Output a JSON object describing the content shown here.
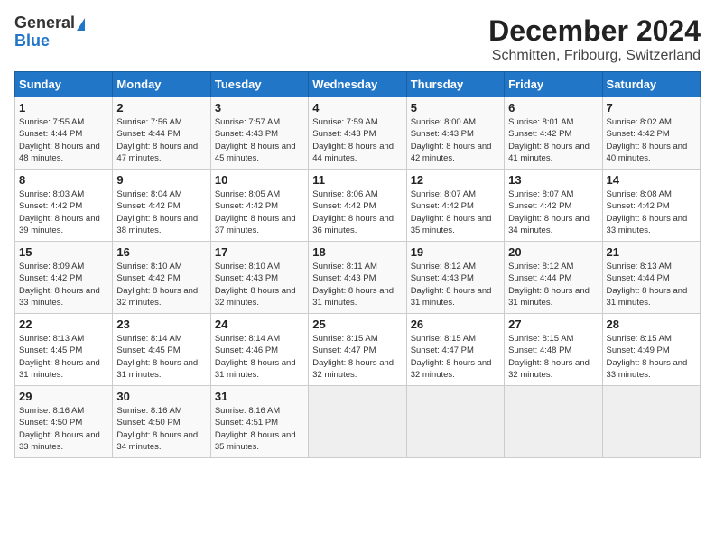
{
  "logo": {
    "general": "General",
    "blue": "Blue"
  },
  "title": "December 2024",
  "location": "Schmitten, Fribourg, Switzerland",
  "headers": [
    "Sunday",
    "Monday",
    "Tuesday",
    "Wednesday",
    "Thursday",
    "Friday",
    "Saturday"
  ],
  "weeks": [
    [
      {
        "day": 1,
        "sunrise": "7:55 AM",
        "sunset": "4:44 PM",
        "daylight": "8 hours and 48 minutes."
      },
      {
        "day": 2,
        "sunrise": "7:56 AM",
        "sunset": "4:44 PM",
        "daylight": "8 hours and 47 minutes."
      },
      {
        "day": 3,
        "sunrise": "7:57 AM",
        "sunset": "4:43 PM",
        "daylight": "8 hours and 45 minutes."
      },
      {
        "day": 4,
        "sunrise": "7:59 AM",
        "sunset": "4:43 PM",
        "daylight": "8 hours and 44 minutes."
      },
      {
        "day": 5,
        "sunrise": "8:00 AM",
        "sunset": "4:43 PM",
        "daylight": "8 hours and 42 minutes."
      },
      {
        "day": 6,
        "sunrise": "8:01 AM",
        "sunset": "4:42 PM",
        "daylight": "8 hours and 41 minutes."
      },
      {
        "day": 7,
        "sunrise": "8:02 AM",
        "sunset": "4:42 PM",
        "daylight": "8 hours and 40 minutes."
      }
    ],
    [
      {
        "day": 8,
        "sunrise": "8:03 AM",
        "sunset": "4:42 PM",
        "daylight": "8 hours and 39 minutes."
      },
      {
        "day": 9,
        "sunrise": "8:04 AM",
        "sunset": "4:42 PM",
        "daylight": "8 hours and 38 minutes."
      },
      {
        "day": 10,
        "sunrise": "8:05 AM",
        "sunset": "4:42 PM",
        "daylight": "8 hours and 37 minutes."
      },
      {
        "day": 11,
        "sunrise": "8:06 AM",
        "sunset": "4:42 PM",
        "daylight": "8 hours and 36 minutes."
      },
      {
        "day": 12,
        "sunrise": "8:07 AM",
        "sunset": "4:42 PM",
        "daylight": "8 hours and 35 minutes."
      },
      {
        "day": 13,
        "sunrise": "8:07 AM",
        "sunset": "4:42 PM",
        "daylight": "8 hours and 34 minutes."
      },
      {
        "day": 14,
        "sunrise": "8:08 AM",
        "sunset": "4:42 PM",
        "daylight": "8 hours and 33 minutes."
      }
    ],
    [
      {
        "day": 15,
        "sunrise": "8:09 AM",
        "sunset": "4:42 PM",
        "daylight": "8 hours and 33 minutes."
      },
      {
        "day": 16,
        "sunrise": "8:10 AM",
        "sunset": "4:42 PM",
        "daylight": "8 hours and 32 minutes."
      },
      {
        "day": 17,
        "sunrise": "8:10 AM",
        "sunset": "4:43 PM",
        "daylight": "8 hours and 32 minutes."
      },
      {
        "day": 18,
        "sunrise": "8:11 AM",
        "sunset": "4:43 PM",
        "daylight": "8 hours and 31 minutes."
      },
      {
        "day": 19,
        "sunrise": "8:12 AM",
        "sunset": "4:43 PM",
        "daylight": "8 hours and 31 minutes."
      },
      {
        "day": 20,
        "sunrise": "8:12 AM",
        "sunset": "4:44 PM",
        "daylight": "8 hours and 31 minutes."
      },
      {
        "day": 21,
        "sunrise": "8:13 AM",
        "sunset": "4:44 PM",
        "daylight": "8 hours and 31 minutes."
      }
    ],
    [
      {
        "day": 22,
        "sunrise": "8:13 AM",
        "sunset": "4:45 PM",
        "daylight": "8 hours and 31 minutes."
      },
      {
        "day": 23,
        "sunrise": "8:14 AM",
        "sunset": "4:45 PM",
        "daylight": "8 hours and 31 minutes."
      },
      {
        "day": 24,
        "sunrise": "8:14 AM",
        "sunset": "4:46 PM",
        "daylight": "8 hours and 31 minutes."
      },
      {
        "day": 25,
        "sunrise": "8:15 AM",
        "sunset": "4:47 PM",
        "daylight": "8 hours and 32 minutes."
      },
      {
        "day": 26,
        "sunrise": "8:15 AM",
        "sunset": "4:47 PM",
        "daylight": "8 hours and 32 minutes."
      },
      {
        "day": 27,
        "sunrise": "8:15 AM",
        "sunset": "4:48 PM",
        "daylight": "8 hours and 32 minutes."
      },
      {
        "day": 28,
        "sunrise": "8:15 AM",
        "sunset": "4:49 PM",
        "daylight": "8 hours and 33 minutes."
      }
    ],
    [
      {
        "day": 29,
        "sunrise": "8:16 AM",
        "sunset": "4:50 PM",
        "daylight": "8 hours and 33 minutes."
      },
      {
        "day": 30,
        "sunrise": "8:16 AM",
        "sunset": "4:50 PM",
        "daylight": "8 hours and 34 minutes."
      },
      {
        "day": 31,
        "sunrise": "8:16 AM",
        "sunset": "4:51 PM",
        "daylight": "8 hours and 35 minutes."
      },
      null,
      null,
      null,
      null
    ]
  ]
}
